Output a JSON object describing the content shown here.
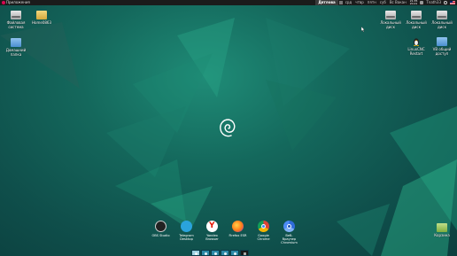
{
  "top_panel": {
    "menu_label": "Приложения",
    "network_label": "Дятлова",
    "days": [
      "срд",
      "чтвр",
      "пятн",
      "суб",
      "Вс Вакан"
    ],
    "clock_line1": "21:35",
    "clock_line2": "20.01",
    "user": "Tnath33"
  },
  "desktop_icons_left": [
    {
      "label": "Файловая система",
      "icon": "drive-icon"
    },
    {
      "label": "Home0863",
      "icon": "home-folder-icon"
    },
    {
      "label": "Домашний папка",
      "icon": "folder-icon"
    }
  ],
  "desktop_icons_right": [
    {
      "label": "Локальный диск",
      "icon": "drive-icon"
    },
    {
      "label": "Локальный диск",
      "icon": "drive-icon"
    },
    {
      "label": "Локальный диск",
      "icon": "drive-icon"
    },
    {
      "label": "LinuxCNC Restart",
      "icon": "penguin-icon"
    },
    {
      "label": "VB общий доступ",
      "icon": "folder-icon"
    },
    {
      "label": "Корзина",
      "icon": "trash-icon"
    }
  ],
  "dock": [
    {
      "label1": "OBS Studio",
      "label2": "",
      "icon": "obs-icon",
      "color": "#222222"
    },
    {
      "label1": "Telegram",
      "label2": "Desktop",
      "icon": "telegram-icon",
      "color": "#2aa3dc"
    },
    {
      "label1": "Yandex",
      "label2": "Browser",
      "icon": "yandex-icon",
      "color": "#ffffff"
    },
    {
      "label1": "Firefox ESR",
      "label2": "",
      "icon": "firefox-icon",
      "color": "#ff7a1a"
    },
    {
      "label1": "Google",
      "label2": "Chrome",
      "icon": "chrome-icon",
      "color": "#e8e8e8"
    },
    {
      "label1": "Веб-браузер",
      "label2": "Chromium",
      "icon": "chromium-icon",
      "color": "#4c8bf5"
    }
  ],
  "colors": {
    "accent": "#1f8c77",
    "panel": "#1b1b1b",
    "debian_red": "#d70751"
  }
}
